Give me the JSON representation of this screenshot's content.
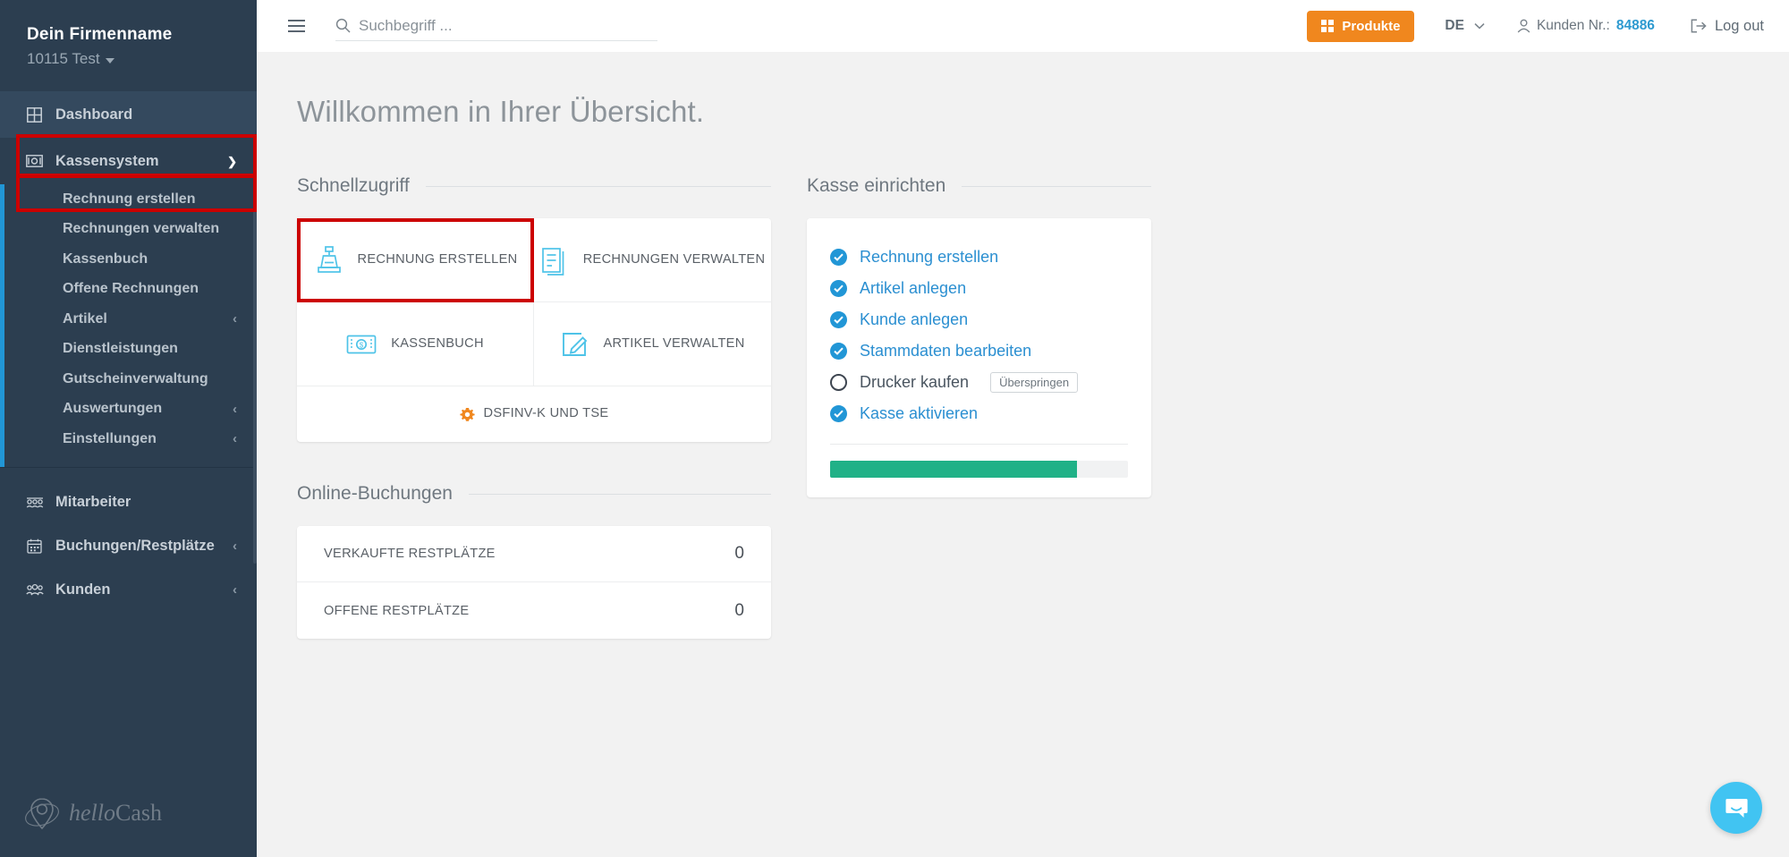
{
  "sidebar": {
    "company": "Dein Firmenname",
    "location": "10115 Test",
    "dashboard": {
      "label": "Dashboard",
      "icon": "grid-icon"
    },
    "kassensystem": {
      "label": "Kassensystem",
      "icon": "cash-note-icon",
      "chevron": "chevron-down-icon"
    },
    "sub_items": [
      {
        "label": "Rechnung erstellen",
        "chevron": ""
      },
      {
        "label": "Rechnungen verwalten",
        "chevron": ""
      },
      {
        "label": "Kassenbuch",
        "chevron": ""
      },
      {
        "label": "Offene Rechnungen",
        "chevron": ""
      },
      {
        "label": "Artikel",
        "chevron": "‹"
      },
      {
        "label": "Dienstleistungen",
        "chevron": ""
      },
      {
        "label": "Gutscheinverwaltung",
        "chevron": ""
      },
      {
        "label": "Auswertungen",
        "chevron": "‹"
      },
      {
        "label": "Einstellungen",
        "chevron": "‹"
      }
    ],
    "bottom_items": [
      {
        "label": "Mitarbeiter",
        "icon": "employees-icon",
        "chevron": ""
      },
      {
        "label": "Buchungen/Restplätze",
        "icon": "calendar-icon",
        "chevron": "‹"
      },
      {
        "label": "Kunden",
        "icon": "customers-icon",
        "chevron": "‹"
      }
    ],
    "logo": {
      "text_1": "hello",
      "text_2": "Cash",
      "icon": "location-pin-logo"
    }
  },
  "topbar": {
    "menu_icon": "hamburger-icon",
    "search": {
      "placeholder": "Suchbegriff ...",
      "value": "",
      "icon": "search-icon"
    },
    "produkte": {
      "label": "Produkte",
      "icon": "grid-icon"
    },
    "language": {
      "value": "DE",
      "chevron": "chevron-down-icon"
    },
    "customer": {
      "label": "Kunden Nr.:",
      "number": "84886",
      "icon": "user-icon"
    },
    "logout": {
      "label": "Log out",
      "icon": "logout-icon"
    }
  },
  "page": {
    "title": "Willkommen in Ihrer Übersicht."
  },
  "quick_access": {
    "section_title": "Schnellzugriff",
    "tiles": [
      {
        "label": "Rechnung erstellen",
        "icon": "cash-register-icon"
      },
      {
        "label": "Rechnungen verwalten",
        "icon": "documents-icon"
      },
      {
        "label": "Kassenbuch",
        "icon": "banknote-icon"
      },
      {
        "label": "Artikel verwalten",
        "icon": "edit-document-icon"
      }
    ],
    "wide_tile": {
      "label": "DSFINV-K und TSE",
      "icon": "gear-icon"
    }
  },
  "setup": {
    "section_title": "Kasse einrichten",
    "items": [
      {
        "label": "Rechnung erstellen",
        "done": true
      },
      {
        "label": "Artikel anlegen",
        "done": true
      },
      {
        "label": "Kunde anlegen",
        "done": true
      },
      {
        "label": "Stammdaten bearbeiten",
        "done": true
      },
      {
        "label": "Drucker kaufen",
        "done": false,
        "skip_label": "Überspringen"
      },
      {
        "label": "Kasse aktivieren",
        "done": true
      }
    ],
    "progress_percent": 83
  },
  "online_bookings": {
    "section_title": "Online-Buchungen",
    "rows": [
      {
        "label": "Verkaufte Restplätze",
        "value": "0"
      },
      {
        "label": "Offene Restplätze",
        "value": "0"
      }
    ]
  },
  "chat": {
    "icon": "chat-bubble-icon"
  },
  "colors": {
    "sidebar_bg": "#2c3e50",
    "accent_blue": "#2196d6",
    "orange": "#f0871e",
    "green": "#20b187",
    "cyan": "#4ec3e8",
    "highlight_red": "#cc0000"
  }
}
